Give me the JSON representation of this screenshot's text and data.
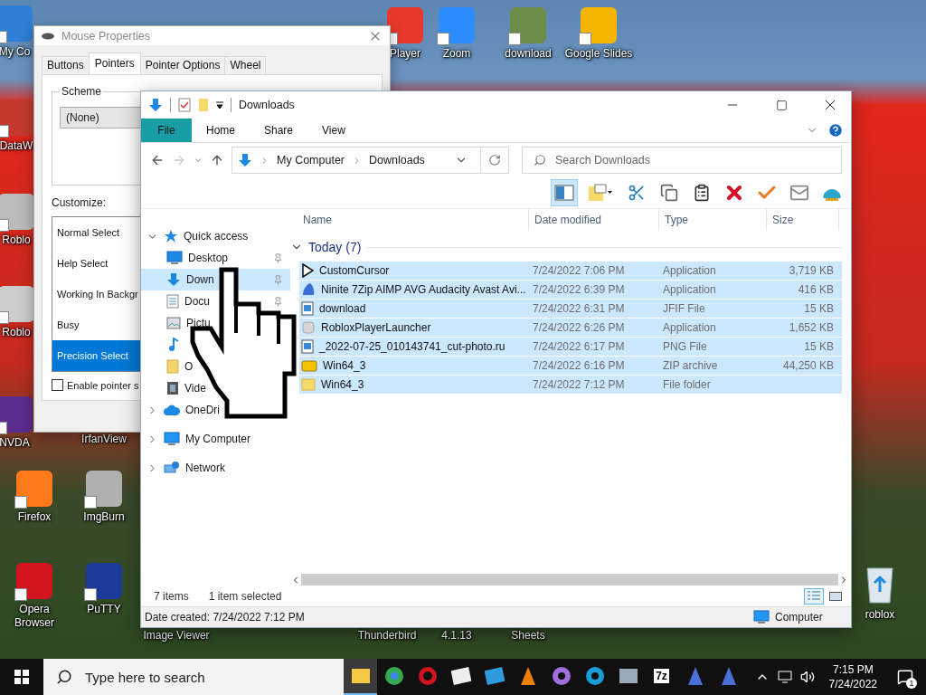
{
  "desktop_icons": [
    {
      "label": "My Co",
      "kind": "app"
    },
    {
      "label": "Player",
      "kind": "app"
    },
    {
      "label": "Zoom",
      "kind": "app"
    },
    {
      "label": "download",
      "kind": "app"
    },
    {
      "label": "Google Slides",
      "kind": "app"
    },
    {
      "label": "DataW",
      "kind": "app"
    },
    {
      "label": "Roblo",
      "kind": "app"
    },
    {
      "label": "Roblo",
      "kind": "app"
    },
    {
      "label": "NVDA",
      "kind": "app"
    },
    {
      "label": "IrfanView",
      "kind": "label"
    },
    {
      "label": "Firefox",
      "kind": "app"
    },
    {
      "label": "ImgBurn",
      "kind": "app"
    },
    {
      "label": "Opera Browser",
      "kind": "app"
    },
    {
      "label": "PuTTY",
      "kind": "app"
    },
    {
      "label": "Image Viewer",
      "kind": "label"
    },
    {
      "label": "Thunderbird",
      "kind": "label"
    },
    {
      "label": "4.1.13",
      "kind": "label"
    },
    {
      "label": "Sheets",
      "kind": "label"
    },
    {
      "label": "roblox",
      "kind": "bin"
    }
  ],
  "mouse_dialog": {
    "title": "Mouse Properties",
    "tabs": [
      {
        "label": "Buttons",
        "selected": false
      },
      {
        "label": "Pointers",
        "selected": true
      },
      {
        "label": "Pointer Options",
        "selected": false
      },
      {
        "label": "Wheel",
        "selected": false
      }
    ],
    "scheme_label": "Scheme",
    "scheme_value": "(None)",
    "customize_label": "Customize:",
    "pointers": [
      {
        "label": "Normal Select",
        "selected": false
      },
      {
        "label": "Help Select",
        "selected": false
      },
      {
        "label": "Working In Backgr",
        "selected": false
      },
      {
        "label": "Busy",
        "selected": false
      },
      {
        "label": "Precision Select",
        "selected": true
      }
    ],
    "shadow_checkbox": {
      "label": "Enable pointer s",
      "checked": false
    }
  },
  "explorer": {
    "title": "Downloads",
    "ribbon_tabs": [
      {
        "label": "File",
        "selected": true
      },
      {
        "label": "Home",
        "selected": false
      },
      {
        "label": "Share",
        "selected": false
      },
      {
        "label": "View",
        "selected": false
      }
    ],
    "address": [
      "My Computer",
      "Downloads"
    ],
    "search": {
      "placeholder": "Search Downloads"
    },
    "toolbar": [
      {
        "kind": "preview-pane",
        "selected": true
      },
      {
        "kind": "new-folder",
        "selected": false
      },
      {
        "kind": "cut",
        "selected": false
      },
      {
        "kind": "copy",
        "selected": false
      },
      {
        "kind": "paste",
        "selected": false
      },
      {
        "kind": "delete",
        "selected": false
      },
      {
        "kind": "check",
        "selected": false
      },
      {
        "kind": "rename",
        "selected": false
      },
      {
        "kind": "shell",
        "selected": false
      }
    ],
    "nav": [
      {
        "label": "Quick access",
        "kind": "star",
        "expanded": true,
        "selected": false,
        "children": [
          {
            "label": "Desktop",
            "kind": "desktop",
            "pinned": true,
            "selected": false
          },
          {
            "label": "Down",
            "kind": "download",
            "pinned": true,
            "selected": true
          },
          {
            "label": "Docu",
            "kind": "document",
            "pinned": true,
            "selected": false
          },
          {
            "label": "Pictu",
            "kind": "picture",
            "pinned": false,
            "selected": false
          },
          {
            "kind": "music",
            "pinned": false,
            "selected": false
          },
          {
            "label": "O",
            "kind": "folder",
            "pinned": false,
            "selected": false
          },
          {
            "label": "Vide",
            "kind": "video",
            "pinned": false,
            "selected": false
          }
        ]
      },
      {
        "label": "OneDri",
        "kind": "cloud",
        "expanded": false,
        "selected": false
      },
      {
        "label": "My Computer",
        "kind": "computer",
        "expanded": false,
        "selected": false
      },
      {
        "label": "Network",
        "kind": "network",
        "expanded": false,
        "selected": false
      }
    ],
    "columns": [
      "Name",
      "Date modified",
      "Type",
      "Size"
    ],
    "group": {
      "label": "Today (7)",
      "expanded": true
    },
    "files": [
      {
        "name": "CustomCursor",
        "kind": "cursor",
        "date": "7/24/2022 7:06 PM",
        "type": "Application",
        "size": "3,719 KB",
        "selected": true
      },
      {
        "name": "Ninite 7Zip AIMP AVG Audacity Avast Avi...",
        "kind": "ninite",
        "date": "7/24/2022 6:39 PM",
        "type": "Application",
        "size": "416 KB",
        "selected": true
      },
      {
        "name": "download",
        "kind": "image",
        "date": "7/24/2022 6:31 PM",
        "type": "JFIF File",
        "size": "15 KB",
        "selected": true
      },
      {
        "name": "RobloxPlayerLauncher",
        "kind": "roblox",
        "date": "7/24/2022 6:26 PM",
        "type": "Application",
        "size": "1,652 KB",
        "selected": true
      },
      {
        "name": "_2022-07-25_010143741_cut-photo.ru",
        "kind": "image",
        "date": "7/24/2022 6:17 PM",
        "type": "PNG File",
        "size": "15 KB",
        "selected": true
      },
      {
        "name": "Win64_3",
        "kind": "zip",
        "date": "7/24/2022 6:16 PM",
        "type": "ZIP archive",
        "size": "44,250 KB",
        "selected": true
      },
      {
        "name": "Win64_3",
        "kind": "folder",
        "date": "7/24/2022 7:12 PM",
        "type": "File folder",
        "selected": true
      }
    ],
    "status": {
      "count": "7 items",
      "selection": "1 item selected"
    },
    "views": [
      {
        "kind": "details",
        "selected": true
      },
      {
        "kind": "tiles",
        "selected": false
      }
    ],
    "details_bar": {
      "text": "Date created: 7/24/2022 7:12 PM",
      "location": "Computer"
    }
  },
  "taskbar": {
    "search": {
      "placeholder": "Type here to search"
    },
    "apps": [
      {
        "kind": "explorer",
        "selected": true
      },
      {
        "kind": "chrome",
        "selected": false
      },
      {
        "kind": "opera",
        "selected": false
      },
      {
        "kind": "roblox",
        "selected": false
      },
      {
        "kind": "studio",
        "selected": false
      },
      {
        "kind": "vlc",
        "selected": false
      },
      {
        "kind": "paint",
        "selected": false
      },
      {
        "kind": "edge",
        "selected": false
      },
      {
        "kind": "monitor",
        "selected": false
      },
      {
        "kind": "sevenzip",
        "label": "7z",
        "selected": false
      },
      {
        "kind": "shell",
        "selected": false
      },
      {
        "kind": "shell",
        "selected": false
      }
    ],
    "time": "7:15 PM",
    "date": "7/24/2022",
    "notifications": "1"
  }
}
